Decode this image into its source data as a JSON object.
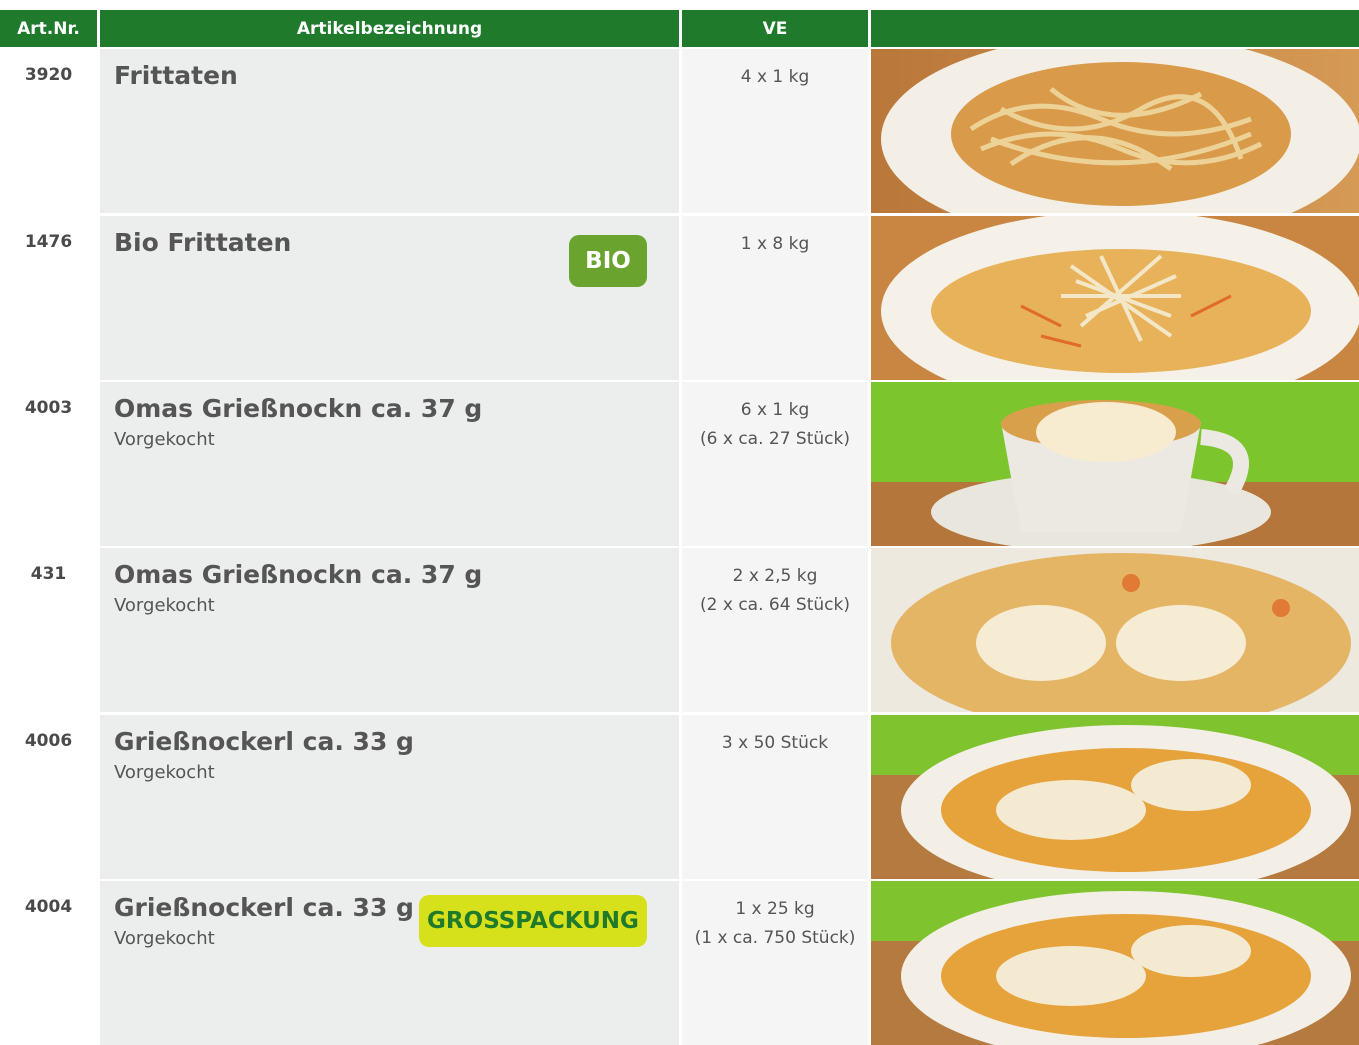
{
  "header": {
    "art_nr": "Art.Nr.",
    "artikelbezeichnung": "Artikelbezeichnung",
    "ve": "VE"
  },
  "rows": [
    {
      "art_nr": "3920",
      "name": "Frittaten",
      "sub": "",
      "ve_line1": "4 x 1 kg",
      "ve_line2": "",
      "badge": "",
      "image": "frittaten-soup"
    },
    {
      "art_nr": "1476",
      "name": "Bio Frittaten",
      "sub": "",
      "ve_line1": "1 x 8 kg",
      "ve_line2": "",
      "badge": "BIO",
      "image": "bio-frittaten-soup"
    },
    {
      "art_nr": "4003",
      "name": "Omas Grießnockn ca. 37 g",
      "sub": "Vorgekocht",
      "ve_line1": "6 x 1 kg",
      "ve_line2": "(6 x ca. 27 Stück)",
      "badge": "",
      "image": "griessnockn-cup"
    },
    {
      "art_nr": "431",
      "name": "Omas Grießnockn ca. 37 g",
      "sub": "Vorgekocht",
      "ve_line1": "2 x 2,5 kg",
      "ve_line2": "(2 x ca. 64 Stück)",
      "badge": "",
      "image": "griessnockn-bowl"
    },
    {
      "art_nr": "4006",
      "name": "Grießnockerl ca. 33 g",
      "sub": "Vorgekocht",
      "ve_line1": "3 x 50 Stück",
      "ve_line2": "",
      "badge": "",
      "image": "griessnockerl-bowl"
    },
    {
      "art_nr": "4004",
      "name": "Grießnockerl ca. 33 g",
      "sub": "Vorgekocht",
      "ve_line1": "1 x 25 kg",
      "ve_line2": "(1 x ca. 750 Stück)",
      "badge": "GROSSPACKUNG",
      "image": "griessnockerl-bowl"
    }
  ],
  "colors": {
    "header_green": "#1f7a2c",
    "bio_badge": "#6aa42e",
    "gross_badge": "#d7e11b"
  }
}
